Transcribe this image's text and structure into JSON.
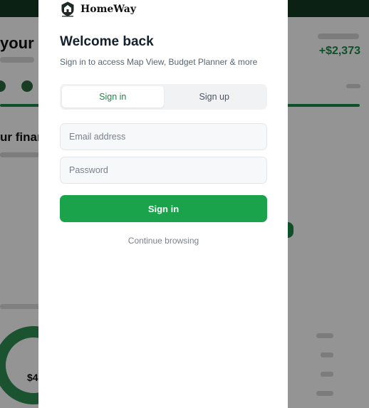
{
  "background_page": {
    "title_fragment": "your",
    "heading_fragment": "ur finan",
    "value_fragment": "+$2,373",
    "donut_fragment": "$4"
  },
  "brand": {
    "name": "HomeWay",
    "logo_icon": "house-crest-logo"
  },
  "auth": {
    "title": "Welcome back",
    "subtitle": "Sign in to access Map View, Budget Planner & more",
    "tabs": [
      {
        "label": "Sign in",
        "active": true
      },
      {
        "label": "Sign up",
        "active": false
      }
    ],
    "email_placeholder": "Email address",
    "password_placeholder": "Password",
    "submit_label": "Sign in",
    "continue_label": "Continue browsing"
  },
  "colors": {
    "accent": "#1ba34c",
    "overlay": "rgba(0,0,0,0.42)"
  }
}
